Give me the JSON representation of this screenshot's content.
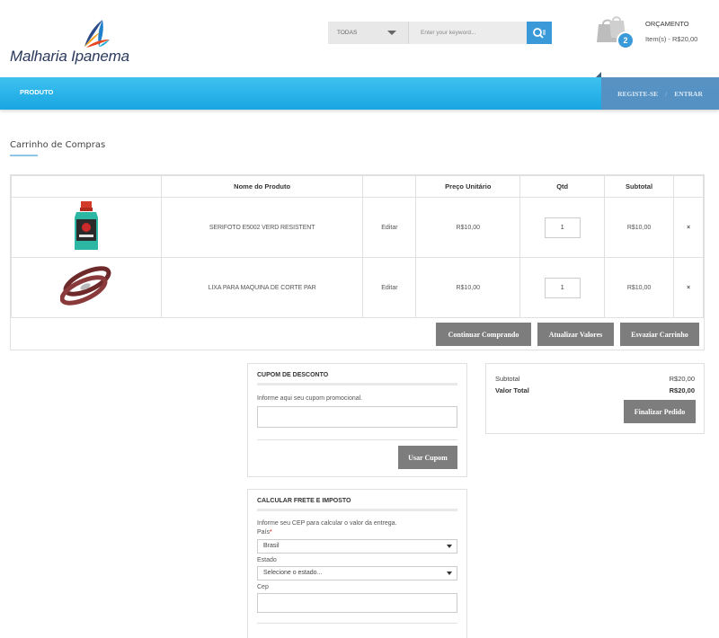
{
  "brand": {
    "name": "Malharia Ipanema"
  },
  "search": {
    "category": "TODAS",
    "placeholder": "Enter your keyword..."
  },
  "mini_cart": {
    "title": "ORÇAMENTO",
    "count": "2",
    "summary": "Item(s) - R$20,00"
  },
  "nav": {
    "produto": "PRODUTO",
    "register": "REGISTE-SE",
    "separator": "/",
    "login": "ENTRAR"
  },
  "page": {
    "title": "Carrinho de Compras"
  },
  "cart_table": {
    "headers": {
      "name": "Nome do Produto",
      "price": "Preço Unitário",
      "qty": "Qtd",
      "subtotal": "Subtotal"
    },
    "rows": [
      {
        "name": "SERIFOTO E5002 VERD RESISTENT",
        "edit": "Editar",
        "price": "R$10,00",
        "qty": "1",
        "subtotal": "R$10,00",
        "remove": "×"
      },
      {
        "name": "LIXA PARA MAQUINA DE CORTE PAR",
        "edit": "Editar",
        "price": "R$10,00",
        "qty": "1",
        "subtotal": "R$10,00",
        "remove": "×"
      }
    ],
    "buttons": {
      "continue": "Continuar Comprando",
      "update": "Atualizar Valores",
      "clear": "Esvaziar Carrinho"
    }
  },
  "coupon": {
    "title": "CUPOM DE DESCONTO",
    "hint": "Informe aqui seu cupom promocional.",
    "button": "Usar Cupom"
  },
  "freight": {
    "title": "CALCULAR FRETE E IMPOSTO",
    "hint": "Informe seu CEP para calcular o valor da entrega.",
    "country_label": "País",
    "required_mark": "*",
    "country_value": "Brasil",
    "state_label": "Estado",
    "state_value": "Selecione o estado...",
    "cep_label": "Cep"
  },
  "totals": {
    "subtotal_label": "Subtotal",
    "subtotal_value": "R$20,00",
    "total_label": "Valor Total",
    "total_value": "R$20,00",
    "checkout_button": "Finalizar Pedido"
  },
  "colors": {
    "accent": "#3a9ad9",
    "nav": "#18a6e3",
    "button": "#7d7d7d"
  }
}
